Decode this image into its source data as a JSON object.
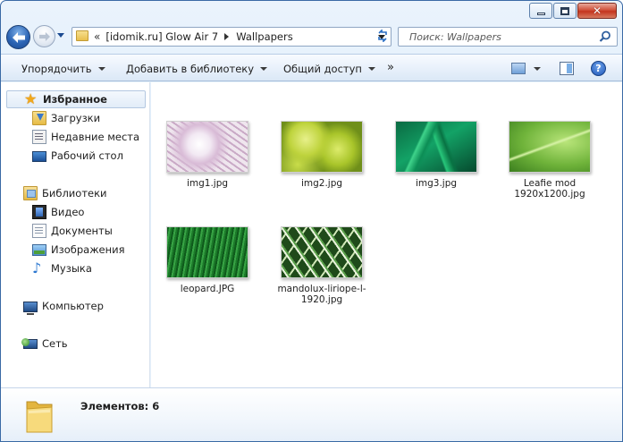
{
  "window": {
    "controls": {
      "minimize": "minimize",
      "maximize": "maximize",
      "close": "✕"
    }
  },
  "address": {
    "chevron": "«",
    "segments": [
      "[idomik.ru] Glow Air 7",
      "Wallpapers"
    ]
  },
  "search": {
    "placeholder": "Поиск: Wallpapers"
  },
  "commands": {
    "organize": "Упорядочить",
    "add_to_library": "Добавить в библиотеку",
    "share": "Общий доступ",
    "more": "»"
  },
  "nav": {
    "favorites": "Избранное",
    "downloads": "Загрузки",
    "recent": "Недавние места",
    "desktop": "Рабочий стол",
    "libraries": "Библиотеки",
    "video": "Видео",
    "documents": "Документы",
    "images": "Изображения",
    "music": "Музыка",
    "computer": "Компьютер",
    "network": "Сеть"
  },
  "files": [
    {
      "name": "img1.jpg"
    },
    {
      "name": "img2.jpg"
    },
    {
      "name": "img3.jpg"
    },
    {
      "name": "Leafie mod 1920x1200.jpg"
    },
    {
      "name": "leopard.JPG"
    },
    {
      "name": "mandolux-liriope-l-1920.jpg"
    }
  ],
  "status": {
    "items_label": "Элементов: 6"
  },
  "colors": {
    "accent": "#3a6aa5",
    "selection": "#e2ecf8"
  }
}
